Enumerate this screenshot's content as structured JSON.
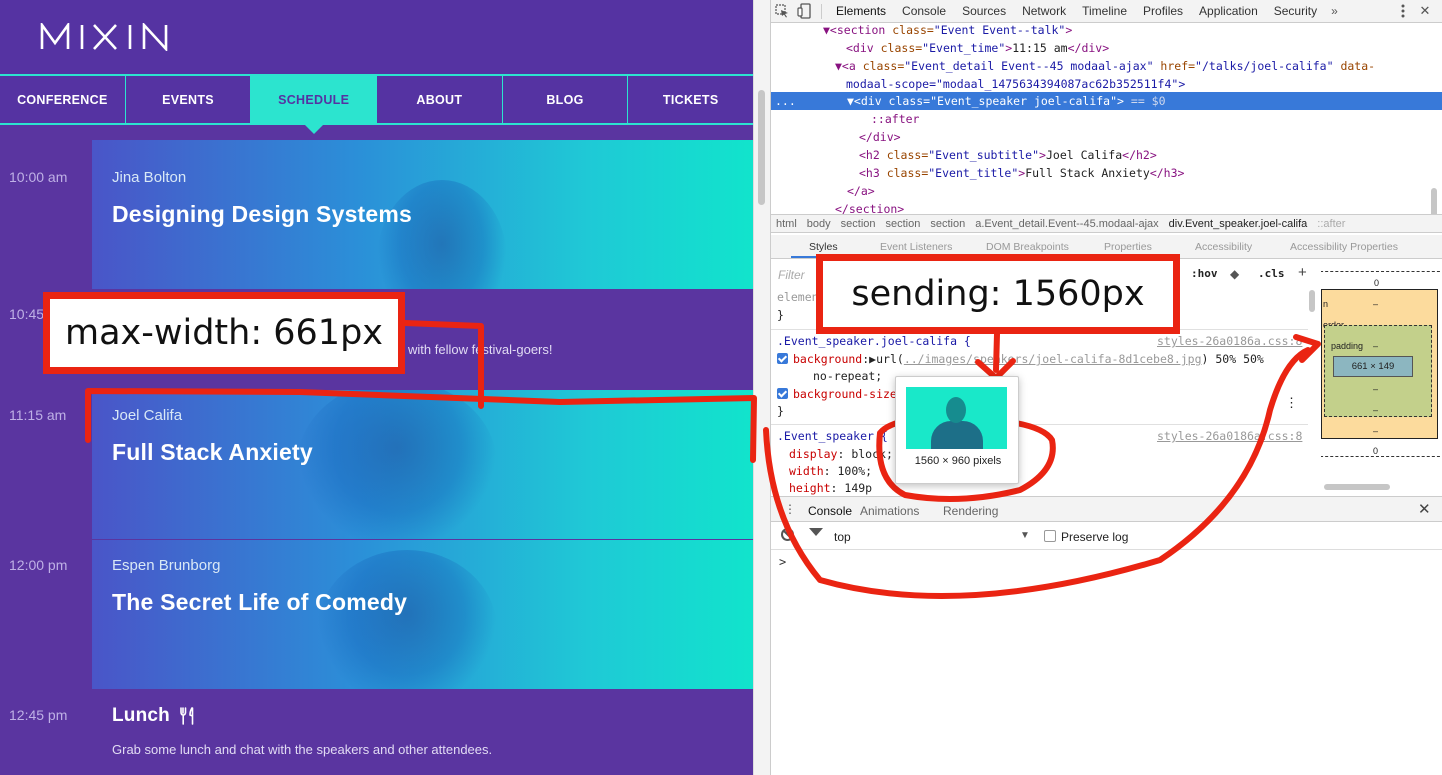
{
  "site": {
    "logo_text": "MIXIN",
    "nav": [
      "CONFERENCE",
      "EVENTS",
      "SCHEDULE",
      "ABOUT",
      "BLOG",
      "TICKETS"
    ],
    "active_nav": "SCHEDULE",
    "schedule": [
      {
        "time": "10:00 am",
        "speaker": "Jina Bolton",
        "title": "Designing Design Systems"
      },
      {
        "time": "10:45",
        "description": "with fellow festival-goers!"
      },
      {
        "time": "11:15 am",
        "speaker": "Joel Califa",
        "title": "Full Stack Anxiety"
      },
      {
        "time": "12:00 pm",
        "speaker": "Espen Brunborg",
        "title": "The Secret Life of Comedy"
      },
      {
        "time": "12:45 pm",
        "title": "Lunch",
        "title_icon": "fork-knife-icon",
        "description": "Grab some lunch and chat with the speakers and other attendees."
      }
    ]
  },
  "devtools": {
    "tabs": [
      "Elements",
      "Console",
      "Sources",
      "Network",
      "Timeline",
      "Profiles",
      "Application",
      "Security"
    ],
    "selected_tab": "Elements",
    "more_tabs": "»",
    "menu_icon": "vertical-dots-icon",
    "close": "✕",
    "dom_lines": [
      {
        "indent": 0,
        "text_tag_open": "▼<section ",
        "attr": "class=",
        "val": "\"Event Event--talk\"",
        "tag_close": ">"
      },
      {
        "indent": 1,
        "text_tag_open": "<div ",
        "attr": "class=",
        "val": "\"Event_time\"",
        "tag_close": ">",
        "text": "11:15 am",
        "end": "</div>"
      },
      {
        "indent": 1,
        "text_tag_open": "▼<a ",
        "attr": "class=",
        "val": "\"Event_detail Event--45 modaal-ajax\"",
        "attr2": " href=",
        "val2": "\"/talks/joel-califa\"",
        "attr3": " data-",
        "val3": ""
      },
      {
        "indent": 1,
        "text": "modaal-scope=\"modaal_1475634394087ac62b352511f4\">"
      },
      {
        "indent": 2,
        "text_tag_open": "▼<div ",
        "attr": "class=",
        "val": "\"Event_speaker joel-califa\"",
        "tag_close": ">",
        "suffix": " == $0",
        "selected": true
      },
      {
        "indent": 3,
        "text": "::after"
      },
      {
        "indent": 2,
        "text": "</div>"
      },
      {
        "indent": 2,
        "text_tag_open": "<h2 ",
        "attr": "class=",
        "val": "\"Event_subtitle\"",
        "tag_close": ">",
        "text": "Joel Califa",
        "end": "</h2>"
      },
      {
        "indent": 2,
        "text_tag_open": "<h3 ",
        "attr": "class=",
        "val": "\"Event_title\"",
        "tag_close": ">",
        "text": "Full Stack Anxiety",
        "end": "</h3>"
      },
      {
        "indent": 1,
        "text": "</a>"
      },
      {
        "indent": 0,
        "text": "</section>"
      }
    ],
    "selected_marker": "...",
    "breadcrumbs": [
      "html",
      "body",
      "section",
      "section",
      "section",
      "a.Event_detail.Event--45.modaal-ajax",
      "div.Event_speaker.joel-califa",
      "::after"
    ],
    "subtabs": [
      "Styles",
      "Event Listeners",
      "DOM Breakpoints",
      "Properties",
      "Accessibility",
      "Accessibility Properties"
    ],
    "filter_placeholder": "Filter",
    "hov": ":hov",
    "cls": ".cls",
    "plus": "+",
    "rules": {
      "element_label": "element",
      "rule1_selector": ".Event_speaker.joel-califa {",
      "rule1_link": "styles-26a0186a.css:8",
      "rule1_bg_prop": "background",
      "rule1_bg_val_a": "url(",
      "rule1_bg_url": "../images/speakers/joel-califa-8d1cebe8.jpg",
      "rule1_bg_val_b": ") 50% 50%",
      "rule1_bg_cont": "no-repeat;",
      "rule1_bgs_prop": "background-size",
      "rule2_selector": ".Event_speaker {",
      "rule2_link": "styles-26a0186a.css:8",
      "rule2_p1": "display",
      "rule2_v1": "block;",
      "rule2_p2": "width",
      "rule2_v2": "100%;",
      "rule2_p3": "height",
      "rule2_v3": "149p"
    },
    "box_model": {
      "margin_top": "0",
      "margin_label": "n",
      "border_label": "order",
      "padding_label": "padding",
      "dash": "–",
      "content": "661 × 149",
      "bottom": "0"
    },
    "drawer_tabs": [
      "Console",
      "Animations",
      "Rendering"
    ],
    "drawer_selected": "Console",
    "console_context": "top",
    "preserve_log": "Preserve log",
    "prompt": ">"
  },
  "annotations": {
    "max_width": "max-width: 661px",
    "sending": "sending: 1560px",
    "tooltip_caption": "1560 × 960 pixels",
    "stroke_color": "#ea2412"
  }
}
